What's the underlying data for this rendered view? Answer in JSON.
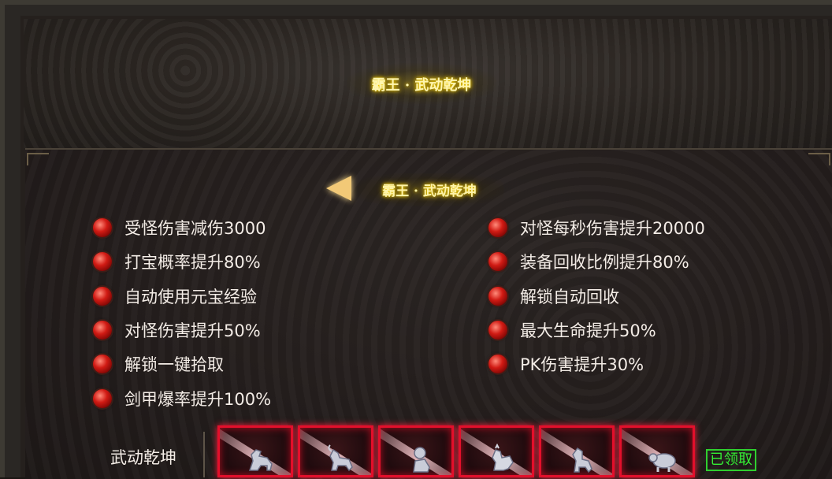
{
  "panel": {
    "title": "霸王 · 武动乾坤",
    "subtitle": "霸王 · 武动乾坤"
  },
  "attributes_left": [
    "受怪伤害减伤3000",
    "打宝概率提升80%",
    "自动使用元宝经验",
    "对怪伤害提升50%",
    "解锁一键拾取",
    "剑甲爆率提升100%"
  ],
  "attributes_right": [
    "对怪每秒伤害提升20000",
    "装备回收比例提升80%",
    "解锁自动回收",
    "最大生命提升50%",
    "PK伤害提升30%"
  ],
  "reward_row": {
    "label": "武动乾坤",
    "items": [
      {
        "icon": "horse-statue-icon"
      },
      {
        "icon": "goat-statue-icon"
      },
      {
        "icon": "monkey-statue-icon"
      },
      {
        "icon": "rooster-statue-icon"
      },
      {
        "icon": "dog-statue-icon"
      },
      {
        "icon": "pig-statue-icon"
      }
    ],
    "status": "已领取"
  },
  "colors": {
    "slot_border": "#e30f2b",
    "claimed": "#34ef34",
    "title_glow": "#ffd800"
  }
}
